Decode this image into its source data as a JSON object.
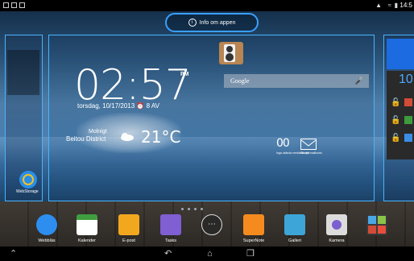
{
  "status_bar": {
    "time": "14:5"
  },
  "info_pill": {
    "label": "Info om appen",
    "icon": "info-icon"
  },
  "clock": {
    "time": "02:57",
    "ampm": "PM",
    "date": "torsdag, 10/17/2013",
    "alarm": "8 AV"
  },
  "weather": {
    "city_line1": "Molnigt",
    "city_line2": "Beitou District",
    "temp": "21°C",
    "icon": "cloudy-sun-icon"
  },
  "search": {
    "label": "Google",
    "icon": "mic-icon"
  },
  "mail_widget": {
    "count": "00",
    "sub_left": "Inga okända meddelanden",
    "sub_right": "Ett nytt mailkonto"
  },
  "desktop": {
    "webstorage_label": "WebStorage"
  },
  "right_panel": {
    "number": "10"
  },
  "dock": {
    "items": [
      {
        "label": "Webbläs",
        "icon": "globe-icon",
        "color": "#2d8ef0"
      },
      {
        "label": "Kalender",
        "icon": "calendar-icon",
        "color": "#3f9e3f"
      },
      {
        "label": "E-post",
        "icon": "mail-icon",
        "color": "#f2a81e"
      },
      {
        "label": "Tasks",
        "icon": "tasks-icon",
        "color": "#7f5fd1"
      },
      {
        "label": "",
        "icon": "apps-icon",
        "color": "#444444"
      },
      {
        "label": "SuperNote",
        "icon": "supernote-icon",
        "color": "#f58b1f"
      },
      {
        "label": "Galleri",
        "icon": "gallery-icon",
        "color": "#3ea5d8"
      },
      {
        "label": "Kamera",
        "icon": "camera-icon",
        "color": "#7b5fd0"
      },
      {
        "label": "",
        "icon": "google-folder-icon",
        "color": "#3a3a3a"
      }
    ]
  },
  "nav": {
    "up": "up-icon",
    "back": "back-icon",
    "home": "home-icon",
    "recent": "recent-apps-icon"
  }
}
